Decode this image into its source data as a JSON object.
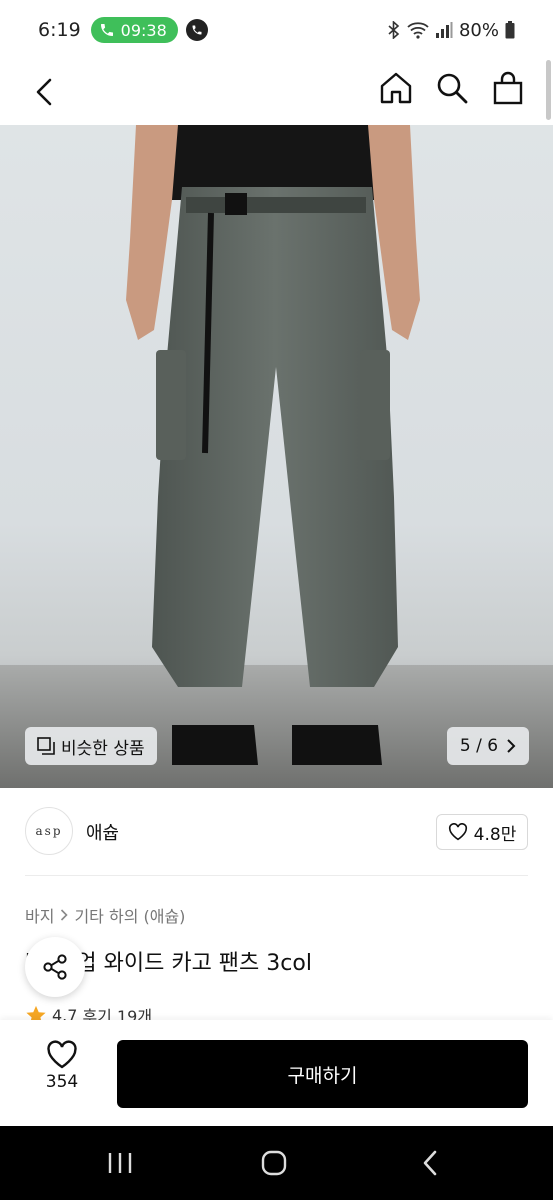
{
  "status_bar": {
    "time": "6:19",
    "call_timer": "09:38",
    "battery": "80%"
  },
  "icons": {
    "back": "chevron-left-icon",
    "home": "home-icon",
    "search": "search-icon",
    "bag": "shopping-bag-icon",
    "heart": "heart-icon",
    "share": "share-icon",
    "star": "star-icon"
  },
  "hero": {
    "similar_label": "비슷한 상품",
    "page_indicator": "5 / 6"
  },
  "brand": {
    "logo_text": "asp",
    "name": "애슙",
    "likes": "4.8만"
  },
  "breadcrumb": {
    "category": "바지",
    "subcategory": "기타 하의 (애슙)"
  },
  "product": {
    "title": "[ ] 웜업 와이드 카고 팬츠 3col",
    "rating": "4.7",
    "reviews": "후기 19개"
  },
  "buy_bar": {
    "wish_count": "354",
    "buy_label": "구매하기"
  },
  "colors": {
    "call_green": "#3fbf5a",
    "buy_button": "#000000",
    "star": "#f5a623"
  }
}
